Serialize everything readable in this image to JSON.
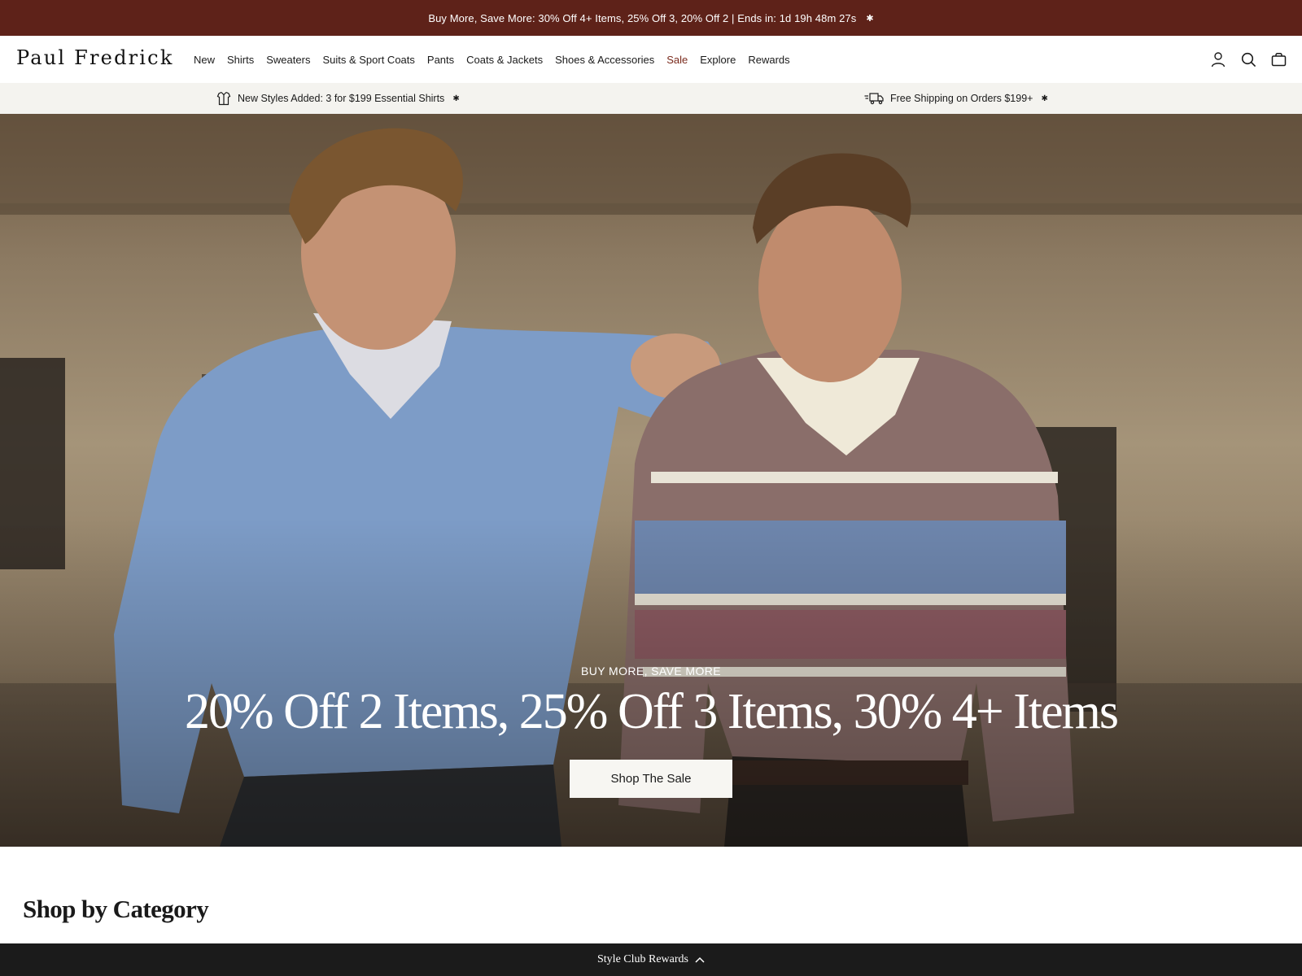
{
  "promo_bar": {
    "text": "Buy More, Save More: 30% Off 4+ Items, 25% Off 3, 20% Off 2 | Ends in: 1d 19h 48m 27s",
    "info_icon": "asterisk-info-icon"
  },
  "header": {
    "logo": "Paul Fredrick",
    "nav": [
      {
        "label": "New"
      },
      {
        "label": "Shirts"
      },
      {
        "label": "Sweaters"
      },
      {
        "label": "Suits & Sport Coats"
      },
      {
        "label": "Pants"
      },
      {
        "label": "Coats & Jackets"
      },
      {
        "label": "Shoes & Accessories"
      },
      {
        "label": "Sale"
      },
      {
        "label": "Explore"
      },
      {
        "label": "Rewards"
      }
    ],
    "icons": [
      "account-icon",
      "search-icon",
      "bag-icon"
    ]
  },
  "subbar": {
    "left_message": "New Styles Added: 3 for $199 Essential Shirts",
    "left_icon": "shirt-icon",
    "right_message": "Free Shipping on Orders $199+",
    "right_icon": "delivery-truck-icon"
  },
  "hero": {
    "eyebrow": "BUY MORE, SAVE MORE",
    "headline": "20% Off 2 Items,  25% Off 3 Items, 30% 4+ Items",
    "cta_label": "Shop The Sale"
  },
  "sections": {
    "category_title": "Shop by Category"
  },
  "rewards_bar": {
    "label": "Style Club Rewards",
    "icon": "chevron-up-icon"
  },
  "colors": {
    "promo_bg": "#5e2219",
    "sale_text": "#7a2a1c",
    "subbar_bg": "#f4f3ef",
    "rewards_bg": "#1b1b1b"
  }
}
